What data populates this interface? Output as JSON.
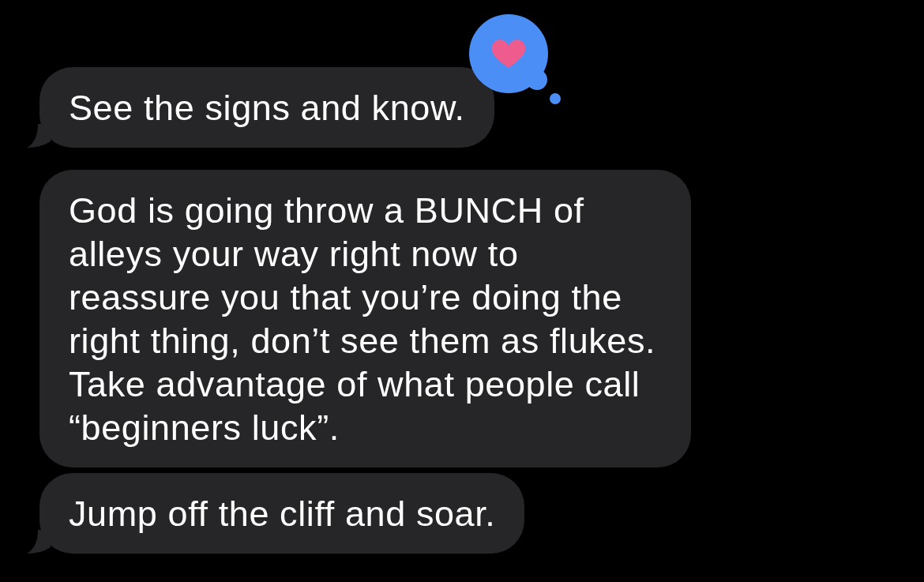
{
  "messages": [
    {
      "text": "See the signs and know.",
      "tail": true,
      "loved": true
    },
    {
      "text": "God is going throw a BUNCH of alleys your way right now to reassure you that you’re doing the right thing, don’t see them as flukes. Take advantage of what people call “beginners luck”.",
      "tail": false
    },
    {
      "text": "Jump off the cliff and soar.",
      "tail": true
    }
  ]
}
